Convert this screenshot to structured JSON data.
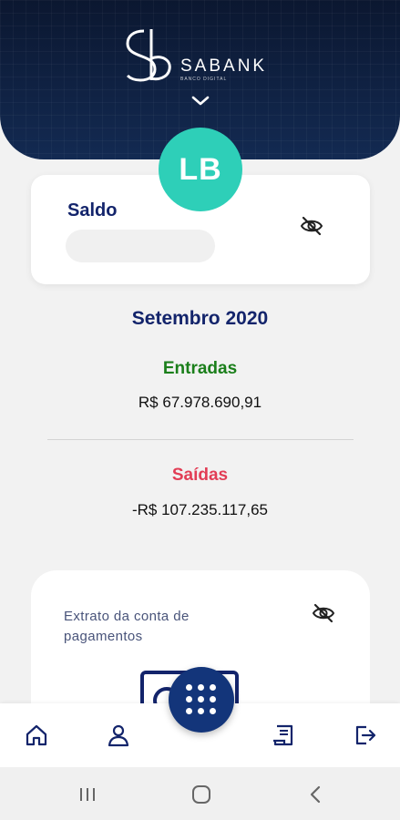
{
  "brand": {
    "name": "SABANK",
    "subtitle": "BANCO DIGITAL"
  },
  "user": {
    "initials": "LB"
  },
  "balance": {
    "label": "Saldo",
    "hidden": true
  },
  "summary": {
    "period": "Setembro 2020",
    "income_label": "Entradas",
    "income_value": "R$ 67.978.690,91",
    "expense_label": "Saídas",
    "expense_value": "-R$ 107.235.117,65"
  },
  "statement": {
    "label": "Extrato da conta de pagamentos"
  },
  "colors": {
    "header": "#0b1730",
    "accent": "#2ecfb8",
    "primary": "#13246b",
    "income": "#1b7f1b",
    "expense": "#e23d55"
  },
  "bottom_nav": [
    "home-icon",
    "profile-icon",
    "keypad-icon",
    "receipt-icon",
    "logout-icon"
  ]
}
